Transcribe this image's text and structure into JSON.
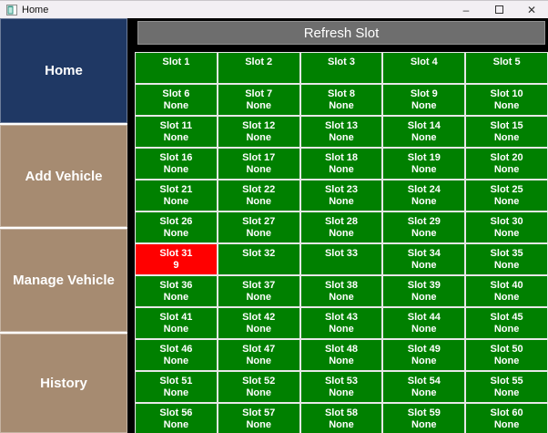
{
  "window": {
    "title": "Home",
    "controls": {
      "minimize": "–",
      "close": "✕"
    }
  },
  "sidebar": {
    "items": [
      {
        "label": "Home",
        "style": "navy"
      },
      {
        "label": "Add Vehicle",
        "style": "tan"
      },
      {
        "label": "Manage Vehicle",
        "style": "tan"
      },
      {
        "label": "History",
        "style": "tan"
      }
    ]
  },
  "main": {
    "refresh_label": "Refresh Slot",
    "slots": [
      {
        "name": "Slot 1",
        "value": "",
        "state": "free"
      },
      {
        "name": "Slot 2",
        "value": "",
        "state": "free"
      },
      {
        "name": "Slot 3",
        "value": "",
        "state": "free"
      },
      {
        "name": "Slot 4",
        "value": "",
        "state": "free"
      },
      {
        "name": "Slot 5",
        "value": "",
        "state": "free"
      },
      {
        "name": "Slot 6",
        "value": "None",
        "state": "free"
      },
      {
        "name": "Slot 7",
        "value": "None",
        "state": "free"
      },
      {
        "name": "Slot 8",
        "value": "None",
        "state": "free"
      },
      {
        "name": "Slot 9",
        "value": "None",
        "state": "free"
      },
      {
        "name": "Slot 10",
        "value": "None",
        "state": "free"
      },
      {
        "name": "Slot 11",
        "value": "None",
        "state": "free"
      },
      {
        "name": "Slot 12",
        "value": "None",
        "state": "free"
      },
      {
        "name": "Slot 13",
        "value": "None",
        "state": "free"
      },
      {
        "name": "Slot 14",
        "value": "None",
        "state": "free"
      },
      {
        "name": "Slot 15",
        "value": "None",
        "state": "free"
      },
      {
        "name": "Slot 16",
        "value": "None",
        "state": "free"
      },
      {
        "name": "Slot 17",
        "value": "None",
        "state": "free"
      },
      {
        "name": "Slot 18",
        "value": "None",
        "state": "free"
      },
      {
        "name": "Slot 19",
        "value": "None",
        "state": "free"
      },
      {
        "name": "Slot 20",
        "value": "None",
        "state": "free"
      },
      {
        "name": "Slot 21",
        "value": "None",
        "state": "free"
      },
      {
        "name": "Slot 22",
        "value": "None",
        "state": "free"
      },
      {
        "name": "Slot 23",
        "value": "None",
        "state": "free"
      },
      {
        "name": "Slot 24",
        "value": "None",
        "state": "free"
      },
      {
        "name": "Slot 25",
        "value": "None",
        "state": "free"
      },
      {
        "name": "Slot 26",
        "value": "None",
        "state": "free"
      },
      {
        "name": "Slot 27",
        "value": "None",
        "state": "free"
      },
      {
        "name": "Slot 28",
        "value": "None",
        "state": "free"
      },
      {
        "name": "Slot 29",
        "value": "None",
        "state": "free"
      },
      {
        "name": "Slot 30",
        "value": "None",
        "state": "free"
      },
      {
        "name": "Slot 31",
        "value": "9",
        "state": "occupied"
      },
      {
        "name": "Slot 32",
        "value": "",
        "state": "free"
      },
      {
        "name": "Slot 33",
        "value": "",
        "state": "free"
      },
      {
        "name": "Slot 34",
        "value": "None",
        "state": "free"
      },
      {
        "name": "Slot 35",
        "value": "None",
        "state": "free"
      },
      {
        "name": "Slot 36",
        "value": "None",
        "state": "free"
      },
      {
        "name": "Slot 37",
        "value": "None",
        "state": "free"
      },
      {
        "name": "Slot 38",
        "value": "None",
        "state": "free"
      },
      {
        "name": "Slot 39",
        "value": "None",
        "state": "free"
      },
      {
        "name": "Slot 40",
        "value": "None",
        "state": "free"
      },
      {
        "name": "Slot 41",
        "value": "None",
        "state": "free"
      },
      {
        "name": "Slot 42",
        "value": "None",
        "state": "free"
      },
      {
        "name": "Slot 43",
        "value": "None",
        "state": "free"
      },
      {
        "name": "Slot 44",
        "value": "None",
        "state": "free"
      },
      {
        "name": "Slot 45",
        "value": "None",
        "state": "free"
      },
      {
        "name": "Slot 46",
        "value": "None",
        "state": "free"
      },
      {
        "name": "Slot 47",
        "value": "None",
        "state": "free"
      },
      {
        "name": "Slot 48",
        "value": "None",
        "state": "free"
      },
      {
        "name": "Slot 49",
        "value": "None",
        "state": "free"
      },
      {
        "name": "Slot 50",
        "value": "None",
        "state": "free"
      },
      {
        "name": "Slot 51",
        "value": "None",
        "state": "free"
      },
      {
        "name": "Slot 52",
        "value": "None",
        "state": "free"
      },
      {
        "name": "Slot 53",
        "value": "None",
        "state": "free"
      },
      {
        "name": "Slot 54",
        "value": "None",
        "state": "free"
      },
      {
        "name": "Slot 55",
        "value": "None",
        "state": "free"
      },
      {
        "name": "Slot 56",
        "value": "None",
        "state": "free"
      },
      {
        "name": "Slot 57",
        "value": "None",
        "state": "free"
      },
      {
        "name": "Slot 58",
        "value": "None",
        "state": "free"
      },
      {
        "name": "Slot 59",
        "value": "None",
        "state": "free"
      },
      {
        "name": "Slot 60",
        "value": "None",
        "state": "free"
      }
    ]
  },
  "colors": {
    "navy": "#1f3864",
    "tan": "#a68b71",
    "free_green": "#008000",
    "occupied_red": "#ff0000",
    "refresh_gray": "#6e6e6e"
  }
}
